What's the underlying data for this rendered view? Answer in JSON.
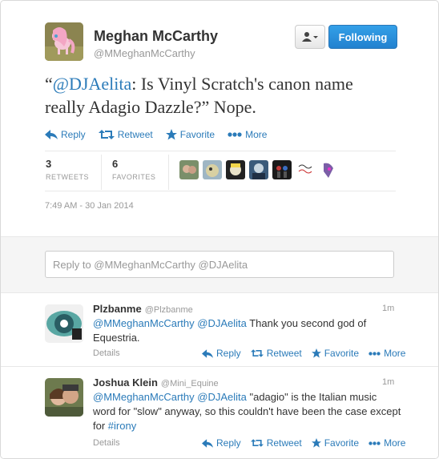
{
  "tweet": {
    "author_name": "Meghan McCarthy",
    "author_handle": "@MMeghanMcCarthy",
    "follow_label": "Following",
    "text_open": "“",
    "mention": "@DJAelita",
    "text_body": ": Is Vinyl Scratch's canon name really Adagio Dazzle?” Nope.",
    "actions": {
      "reply": "Reply",
      "retweet": "Retweet",
      "favorite": "Favorite",
      "more": "More"
    },
    "retweets_count": "3",
    "retweets_label": "RETWEETS",
    "favorites_count": "6",
    "favorites_label": "FAVORITES",
    "timestamp": "7:49 AM - 30 Jan 2014"
  },
  "reply_box": {
    "placeholder": "Reply to @MMeghanMcCarthy @DJAelita"
  },
  "replies": [
    {
      "name": "Plzbanme",
      "handle": "@Plzbanme",
      "time": "1m",
      "mention1": "@MMeghanMcCarthy",
      "mention2": "@DJAelita",
      "text": " Thank you second god of Equestria.",
      "details": "Details"
    },
    {
      "name": "Joshua Klein",
      "handle": "@Mini_Equine",
      "time": "1m",
      "mention1": "@MMeghanMcCarthy",
      "mention2": "@DJAelita",
      "text": " \"adagio\" is the Italian music word for \"slow\" anyway, so this couldn't have been the case except for ",
      "hashtag": "#irony",
      "details": "Details"
    }
  ],
  "colors": {
    "link": "#2b7bb9",
    "follow_button": "#2281cf"
  }
}
